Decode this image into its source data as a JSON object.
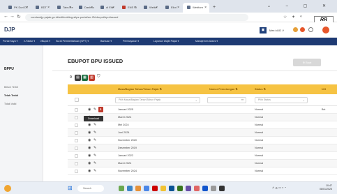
{
  "browser": {
    "tabs": [
      {
        "label": "PK Dori DT"
      },
      {
        "label": "BDT"
      },
      {
        "label": "Tabs Re"
      },
      {
        "label": "Dashbo"
      },
      {
        "label": "di Elte"
      },
      {
        "label": "ENS Si"
      },
      {
        "label": "Welke"
      },
      {
        "label": "Eliot"
      },
      {
        "label": "Webforn"
      }
    ],
    "url": "coretaxdjp.pajak.go.id/withholding-slips-portal/en-ID/ebupot/bpu/issued",
    "rr_badge": "RR"
  },
  "header": {
    "logo": "DJP",
    "selector_label": "Mex id-ID ∨"
  },
  "nav": {
    "items": [
      "Portal Saya ▾",
      "e-Faktur ▾",
      "eBupot ▾",
      "Surat Pemberitahuan (SPT) ▾",
      "Bantuan ▾",
      "Pembayaran ▾",
      "Layanan Wajib Pajak ▾",
      "Manajemen Akses ▾"
    ]
  },
  "sidebar": {
    "title": "BPPU",
    "items": [
      "Belum Terbit",
      "Telah Terbit",
      "Tidak Valid"
    ]
  },
  "main": {
    "title": "EBUPOT BPU ISSUED",
    "action_button": "⊕ Buat",
    "toolbar": {
      "count": "0"
    },
    "columns": [
      "Masa/Bagian Tahun/Tahun Pajak ⇅",
      "Nomor Pemotongan ⇅",
      "Status ⇅",
      "N.S"
    ],
    "filters": {
      "period_placeholder": "Pilih Masa/Bagian Tahun/Tahun Pajak",
      "status_placeholder": "Pilih Status"
    },
    "tooltip": "Download",
    "rows": [
      {
        "period": "Januari 2025",
        "status": "Normal",
        "extra": "Bet"
      },
      {
        "period": "Maret 2024",
        "status": "Normal",
        "extra": ""
      },
      {
        "period": "Mei 2024",
        "status": "Normal",
        "extra": ""
      },
      {
        "period": "Juni 2024",
        "status": "Normal",
        "extra": ""
      },
      {
        "period": "November 2020",
        "status": "Normal",
        "extra": ""
      },
      {
        "period": "Desember 2019",
        "status": "Normal",
        "extra": ""
      },
      {
        "period": "Januari 2022",
        "status": "Normal",
        "extra": ""
      },
      {
        "period": "Maret 2024",
        "status": "Normal",
        "extra": ""
      },
      {
        "period": "November 2024",
        "status": "Normal",
        "extra": ""
      }
    ]
  },
  "taskbar": {
    "search_label": "Search",
    "clock_time": "10:47",
    "clock_date": "08/01/2025"
  },
  "colors": {
    "navbar": "#1e3a73",
    "table_header": "#f6c343",
    "excel_button": "#1d6f42",
    "pdf_button": "#c0392b"
  }
}
